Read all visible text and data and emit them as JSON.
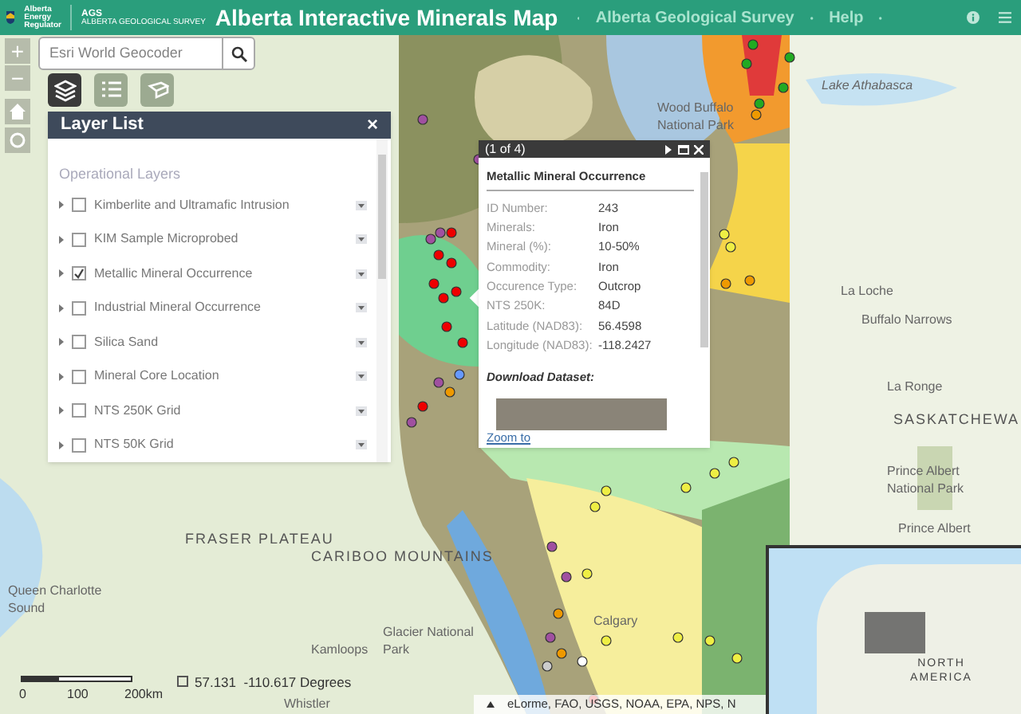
{
  "header": {
    "logo_text": "Alberta Energy Regulator",
    "ags_text": "AGS",
    "ags_sub": "ALBERTA GEOLOGICAL SURVEY",
    "title": "Alberta Interactive Minerals Map",
    "nav": [
      "Alberta Geological Survey",
      "Help"
    ]
  },
  "search": {
    "placeholder": "Esri World Geocoder"
  },
  "zoom": {
    "plus": "+",
    "minus": "−"
  },
  "toolbar": [
    {
      "kind": "layers",
      "selected": true
    },
    {
      "kind": "list",
      "selected": false
    },
    {
      "kind": "legend",
      "selected": false
    }
  ],
  "layer_list": {
    "title": "Layer List",
    "close": "×",
    "section": "Operational Layers",
    "layers": [
      {
        "label": "Kimberlite and Ultramafic Intrusion",
        "checked": false
      },
      {
        "label": "KIM Sample Microprobed",
        "checked": false
      },
      {
        "label": "Metallic Mineral Occurrence",
        "checked": true
      },
      {
        "label": "Industrial Mineral Occurrence",
        "checked": false
      },
      {
        "label": "Silica Sand",
        "checked": false
      },
      {
        "label": "Mineral Core Location",
        "checked": false
      },
      {
        "label": "NTS 250K Grid",
        "checked": false
      },
      {
        "label": "NTS 50K Grid",
        "checked": false
      }
    ]
  },
  "popup": {
    "pager": "(1 of 4)",
    "title": "Metallic Mineral Occurrence",
    "fields": [
      {
        "label": "ID Number:",
        "value": "243"
      },
      {
        "label": "Minerals:",
        "value": "Iron"
      },
      {
        "label": "Mineral (%):",
        "value": "10-50%"
      },
      {
        "label": "Commodity:",
        "value": "Iron"
      },
      {
        "label": "Occurence Type:",
        "value": "Outcrop"
      },
      {
        "label": "NTS 250K:",
        "value": "84D"
      },
      {
        "label": "Latitude (NAD83):",
        "value": "56.4598"
      },
      {
        "label": "Longitude (NAD83):",
        "value": "-118.2427"
      }
    ],
    "download": "Download Dataset:",
    "zoom_link": "Zoom to"
  },
  "map_labels": [
    "Lake Athabasca",
    "Wood Buffalo National Park",
    "La Loche",
    "Buffalo Narrows",
    "La Ronge",
    "SASKATCHEWA",
    "Prince Albert National Park",
    "Prince Albert",
    "FRASER PLATEAU",
    "CARIBOO MOUNTAINS",
    "Queen Charlotte Sound",
    "Kamloops",
    "Glacier National Park",
    "Calgary",
    "Whistler"
  ],
  "scale": {
    "ticks": [
      "0",
      "100",
      "200km"
    ]
  },
  "coordinates": "57.131  -110.617 Degrees",
  "attribution": "eLorme, FAO, USGS, NOAA, EPA, NPS, N",
  "overview": {
    "label": "NORTH AMERICA"
  }
}
